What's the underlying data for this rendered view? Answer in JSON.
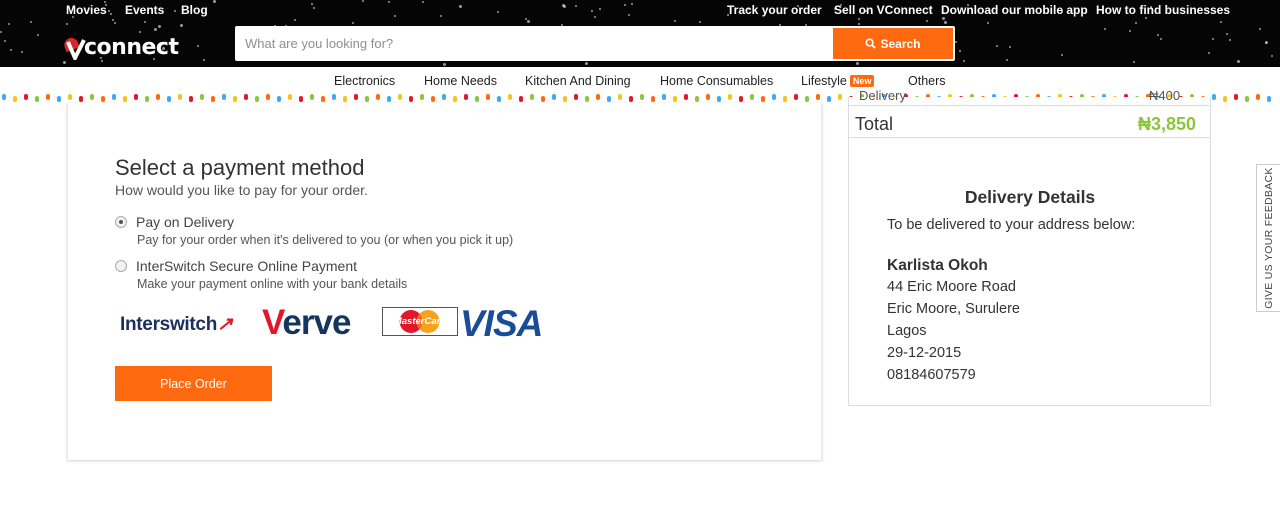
{
  "topnav": {
    "left": [
      "Movies",
      "Events",
      "Blog"
    ],
    "right": [
      "Track your order",
      "Sell on VConnect",
      "Download our mobile app",
      "How to find businesses"
    ]
  },
  "logo": {
    "text": "connect",
    "prefix": "V"
  },
  "search": {
    "placeholder": "What are you looking for?",
    "value": "",
    "button": "Search",
    "icon": "search-icon"
  },
  "categories": [
    "Electronics",
    "Home Needs",
    "Kitchen And Dining",
    "Home Consumables",
    "Lifestyle",
    "Others"
  ],
  "lifestyle_badge": "New",
  "payment": {
    "title": "Select a payment method",
    "subtitle": "How would you like to pay for your order.",
    "options": [
      {
        "label": "Pay on Delivery",
        "description": "Pay for your order when it's delivered to you (or when you pick it up)",
        "selected": true
      },
      {
        "label": "InterSwitch Secure Online Payment",
        "description": "Make your payment online with your bank details",
        "selected": false
      }
    ],
    "brands": {
      "interswitch": "Interswitch",
      "verve_v": "V",
      "verve_rest": "erve",
      "mastercard": "MasterCard",
      "visa": "VISA"
    },
    "place_order": "Place Order"
  },
  "summary": {
    "delivery_label": "Delivery",
    "delivery_value": "₦400",
    "total_label": "Total",
    "total_value": "₦3,850",
    "total_color": "#8cc63f"
  },
  "delivery_details": {
    "title": "Delivery Details",
    "subtitle": "To be delivered to your address below:",
    "name": "Karlista Okoh",
    "address1": "44 Eric Moore Road",
    "address2": "Eric Moore, Surulere",
    "city": "Lagos",
    "date": "29-12-2015",
    "phone": "08184607579"
  },
  "feedback": "GIVE US YOUR FEEDBACK",
  "accent_color": "#ff6a10"
}
